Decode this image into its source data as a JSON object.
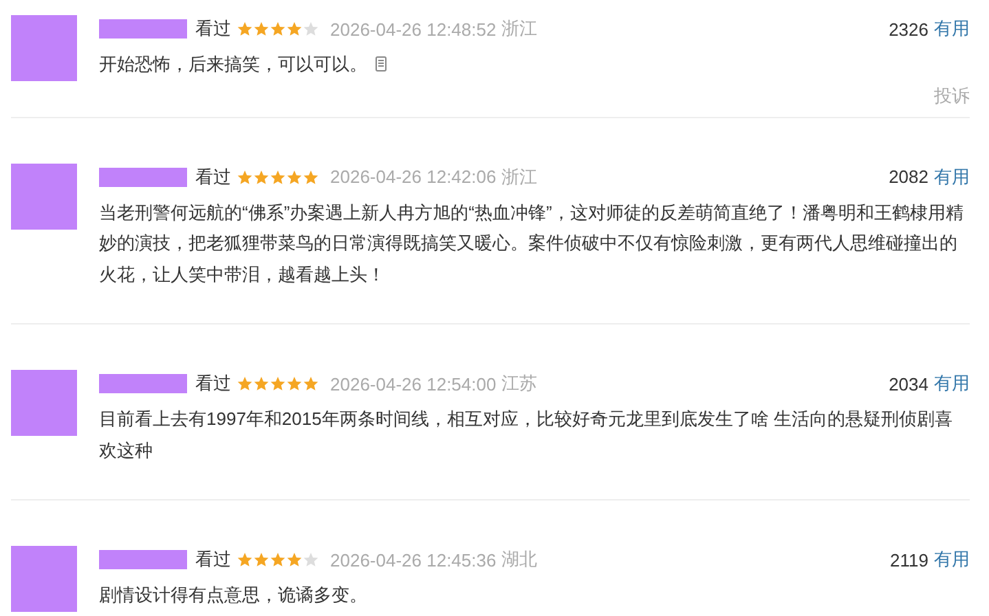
{
  "comments": [
    {
      "status": "看过",
      "stars": 4,
      "time": "2026-04-26 12:48:52",
      "region": "浙江",
      "votes": "2326",
      "vote_label": "有用",
      "text": "开始恐怖，后来搞笑，可以可以。",
      "note_icon": true,
      "report": "投诉"
    },
    {
      "status": "看过",
      "stars": 5,
      "time": "2026-04-26 12:42:06",
      "region": "浙江",
      "votes": "2082",
      "vote_label": "有用",
      "text": "当老刑警何远航的“佛系”办案遇上新人冉方旭的“热血冲锋”，这对师徒的反差萌简直绝了！潘粤明和王鹤棣用精妙的演技，把老狐狸带菜鸟的日常演得既搞笑又暖心。案件侦破中不仅有惊险刺激，更有两代人思维碰撞出的火花，让人笑中带泪，越看越上头！",
      "note_icon": false
    },
    {
      "status": "看过",
      "stars": 5,
      "time": "2026-04-26 12:54:00",
      "region": "江苏",
      "votes": "2034",
      "vote_label": "有用",
      "text": "目前看上去有1997年和2015年两条时间线，相互对应，比较好奇元龙里到底发生了啥 生活向的悬疑刑侦剧喜欢这种",
      "note_icon": false
    },
    {
      "status": "看过",
      "stars": 4,
      "time": "2026-04-26 12:45:36",
      "region": "湖北",
      "votes": "2119",
      "vote_label": "有用",
      "text": "剧情设计得有点意思，诡谲多变。",
      "note_icon": false
    }
  ]
}
